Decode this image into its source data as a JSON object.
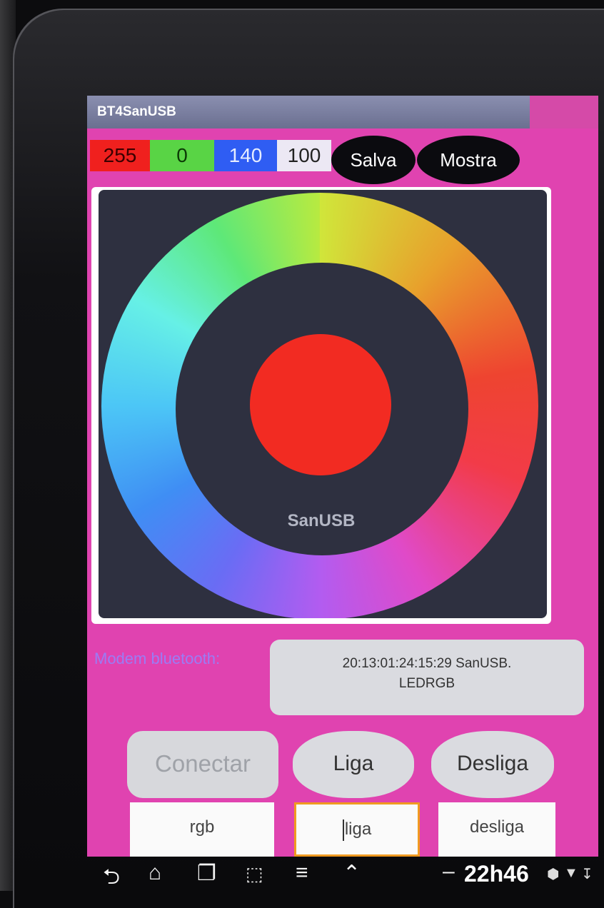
{
  "app": {
    "title": "BT4SanUSB"
  },
  "values": {
    "red": "255",
    "green": "0",
    "blue": "140",
    "white": "100"
  },
  "buttons": {
    "salva": "Salva",
    "mostra": "Mostra",
    "conectar": "Conectar",
    "liga": "Liga",
    "desliga": "Desliga"
  },
  "wheel": {
    "label": "SanUSB",
    "selected_color": "#f22b22"
  },
  "modem": {
    "label": "Modem bluetooth:",
    "line1": "20:13:01:24:15:29 SanUSB.",
    "line2": "LEDRGB"
  },
  "fields": {
    "rgb": "rgb",
    "liga": "liga",
    "desliga": "desliga"
  },
  "navbar": {
    "icons": [
      "back-icon",
      "home-icon",
      "recent-apps-icon",
      "screenshot-icon",
      "menu-icon",
      "up-arrow-icon"
    ],
    "clock": "22h46",
    "separator": "–"
  },
  "colors": {
    "screen_bg": "#e043b0",
    "modem_label": "#9a7cf5",
    "focus_border": "#f09a20"
  }
}
